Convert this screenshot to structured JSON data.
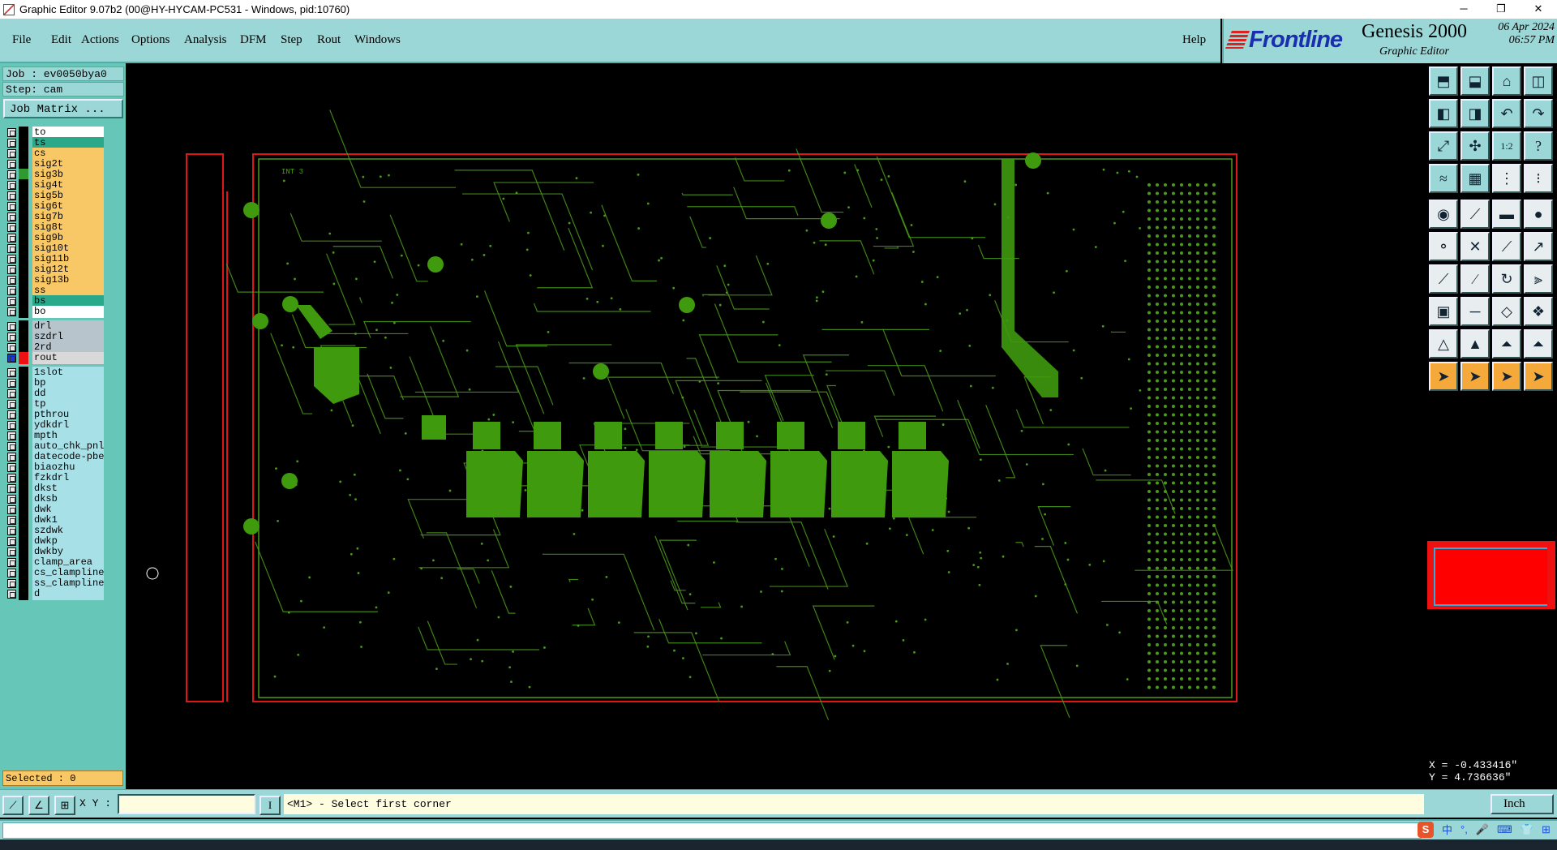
{
  "window": {
    "title": "Graphic Editor 9.07b2 (00@HY-HYCAM-PC531 - Windows, pid:10760)",
    "minimize": "─",
    "restore": "❐",
    "close": "✕"
  },
  "menu": {
    "items": [
      "File",
      "Edit",
      "Actions",
      "Options",
      "Analysis",
      "DFM",
      "Step",
      "Rout",
      "Windows"
    ],
    "help": "Help"
  },
  "brand": {
    "logo": "Frontline",
    "product": "Genesis 2000",
    "subtitle": "Graphic Editor",
    "date": "06 Apr 2024",
    "time": "06:57 PM"
  },
  "job": {
    "job_line": "Job : ev0050bya0",
    "step_line": "Step: cam",
    "matrix_button": "Job Matrix ..."
  },
  "layers": [
    {
      "name": "to",
      "bg": "#ffffff",
      "swatch": "#000000"
    },
    {
      "name": "ts",
      "bg": "#2aa88a",
      "swatch": "#000000"
    },
    {
      "name": "cs",
      "bg": "#f9c866",
      "swatch": "#000000"
    },
    {
      "name": "sig2t",
      "bg": "#f9c866",
      "swatch": "#000000"
    },
    {
      "name": "sig3b",
      "bg": "#f9c866",
      "swatch": "#2f9a2f"
    },
    {
      "name": "sig4t",
      "bg": "#f9c866",
      "swatch": "#000000"
    },
    {
      "name": "sig5b",
      "bg": "#f9c866",
      "swatch": "#000000"
    },
    {
      "name": "sig6t",
      "bg": "#f9c866",
      "swatch": "#000000"
    },
    {
      "name": "sig7b",
      "bg": "#f9c866",
      "swatch": "#000000"
    },
    {
      "name": "sig8t",
      "bg": "#f9c866",
      "swatch": "#000000"
    },
    {
      "name": "sig9b",
      "bg": "#f9c866",
      "swatch": "#000000"
    },
    {
      "name": "sig10t",
      "bg": "#f9c866",
      "swatch": "#000000"
    },
    {
      "name": "sig11b",
      "bg": "#f9c866",
      "swatch": "#000000"
    },
    {
      "name": "sig12t",
      "bg": "#f9c866",
      "swatch": "#000000"
    },
    {
      "name": "sig13b",
      "bg": "#f9c866",
      "swatch": "#000000"
    },
    {
      "name": "ss",
      "bg": "#f9c866",
      "swatch": "#000000"
    },
    {
      "name": "bs",
      "bg": "#2aa88a",
      "swatch": "#000000"
    },
    {
      "name": "bo",
      "bg": "#ffffff",
      "swatch": "#000000"
    },
    {
      "name": "drl",
      "bg": "#b7c4cc",
      "swatch": "#000000",
      "gap": true
    },
    {
      "name": "szdrl",
      "bg": "#b7c4cc",
      "swatch": "#000000"
    },
    {
      "name": "2rd",
      "bg": "#b7c4cc",
      "swatch": "#000000"
    },
    {
      "name": "rout",
      "bg": "#d9d9d9",
      "swatch": "#ee1111",
      "active": true
    },
    {
      "name": "1slot",
      "bg": "#a8e0e8",
      "swatch": "#000000",
      "gap": true
    },
    {
      "name": "bp",
      "bg": "#a8e0e8",
      "swatch": "#000000"
    },
    {
      "name": "dd",
      "bg": "#a8e0e8",
      "swatch": "#000000"
    },
    {
      "name": "tp",
      "bg": "#a8e0e8",
      "swatch": "#000000"
    },
    {
      "name": "pthrou",
      "bg": "#a8e0e8",
      "swatch": "#000000"
    },
    {
      "name": "ydkdrl",
      "bg": "#a8e0e8",
      "swatch": "#000000"
    },
    {
      "name": "mpth",
      "bg": "#a8e0e8",
      "swatch": "#000000"
    },
    {
      "name": "auto_chk_pnl",
      "bg": "#a8e0e8",
      "swatch": "#000000"
    },
    {
      "name": "datecode-pbe",
      "bg": "#a8e0e8",
      "swatch": "#000000"
    },
    {
      "name": "biaozhu",
      "bg": "#a8e0e8",
      "swatch": "#000000"
    },
    {
      "name": "fzkdrl",
      "bg": "#a8e0e8",
      "swatch": "#000000"
    },
    {
      "name": "dkst",
      "bg": "#a8e0e8",
      "swatch": "#000000"
    },
    {
      "name": "dksb",
      "bg": "#a8e0e8",
      "swatch": "#000000"
    },
    {
      "name": "dwk",
      "bg": "#a8e0e8",
      "swatch": "#000000"
    },
    {
      "name": "dwk1",
      "bg": "#a8e0e8",
      "swatch": "#000000"
    },
    {
      "name": "szdwk",
      "bg": "#a8e0e8",
      "swatch": "#000000"
    },
    {
      "name": "dwkp",
      "bg": "#a8e0e8",
      "swatch": "#000000"
    },
    {
      "name": "dwkby",
      "bg": "#a8e0e8",
      "swatch": "#000000"
    },
    {
      "name": "clamp_area",
      "bg": "#a8e0e8",
      "swatch": "#000000"
    },
    {
      "name": "cs_clampline",
      "bg": "#a8e0e8",
      "swatch": "#000000"
    },
    {
      "name": "ss_clampline",
      "bg": "#a8e0e8",
      "swatch": "#000000"
    },
    {
      "name": "d",
      "bg": "#a8e0e8",
      "swatch": "#000000"
    }
  ],
  "selected": "Selected : 0",
  "board": {
    "label": "INT 3",
    "colors": {
      "outline": "#e01515",
      "trace": "#4a9a1a",
      "copper": "#3f9a0e"
    }
  },
  "toolbar": [
    {
      "icon": "open-step-icon",
      "glyph": "⬒",
      "style": "cyan"
    },
    {
      "icon": "save-icon",
      "glyph": "⬓",
      "style": "cyan"
    },
    {
      "icon": "home-icon",
      "glyph": "⌂",
      "style": "cyan"
    },
    {
      "icon": "layout-icon",
      "glyph": "◫",
      "style": "cyan"
    },
    {
      "icon": "pan-left-icon",
      "glyph": "◧",
      "style": "cyan"
    },
    {
      "icon": "pan-right-icon",
      "glyph": "◨",
      "style": "cyan"
    },
    {
      "icon": "zoom-back-icon",
      "glyph": "↶",
      "style": "cyan"
    },
    {
      "icon": "zoom-forward-icon",
      "glyph": "↷",
      "style": "cyan"
    },
    {
      "icon": "zoom-fit-icon",
      "glyph": "⤢",
      "style": "cyan"
    },
    {
      "icon": "zoom-center-icon",
      "glyph": "✣",
      "style": "cyan"
    },
    {
      "icon": "zoom-1to2-icon",
      "glyph": "1:2",
      "style": "cyan"
    },
    {
      "icon": "help-icon",
      "glyph": "?",
      "style": "cyan"
    },
    {
      "icon": "snap-icon",
      "glyph": "≈",
      "style": "cyan"
    },
    {
      "icon": "grid-icon",
      "glyph": "▦",
      "style": "cyan"
    },
    {
      "icon": "measure-icon",
      "glyph": "⋮",
      "style": "white"
    },
    {
      "icon": "measure-points-icon",
      "glyph": "⁝",
      "style": "white"
    },
    {
      "icon": "select-pad-icon",
      "glyph": "◉",
      "style": "white"
    },
    {
      "icon": "select-line-icon",
      "glyph": "⟋",
      "style": "white"
    },
    {
      "icon": "ruler-icon",
      "glyph": "▬",
      "style": "white"
    },
    {
      "icon": "select-feature-icon",
      "glyph": "●",
      "style": "white"
    },
    {
      "icon": "net-select-icon",
      "glyph": "⚬",
      "style": "white"
    },
    {
      "icon": "cross-select-icon",
      "glyph": "✕",
      "style": "white"
    },
    {
      "icon": "connect-icon",
      "glyph": "⟋",
      "style": "white"
    },
    {
      "icon": "connect-arc-icon",
      "glyph": "↗",
      "style": "white"
    },
    {
      "icon": "add-line-icon",
      "glyph": "⟋",
      "style": "white"
    },
    {
      "icon": "add-line2-icon",
      "glyph": "∕",
      "style": "white"
    },
    {
      "icon": "add-arc-icon",
      "glyph": "↻",
      "style": "white"
    },
    {
      "icon": "split-icon",
      "glyph": "⫸",
      "style": "white"
    },
    {
      "icon": "pad-add-icon",
      "glyph": "▣",
      "style": "white"
    },
    {
      "icon": "line-add-icon",
      "glyph": "─",
      "style": "white"
    },
    {
      "icon": "polygon-icon",
      "glyph": "◇",
      "style": "white"
    },
    {
      "icon": "drill-icon",
      "glyph": "❖",
      "style": "white"
    },
    {
      "icon": "triangle-icon",
      "glyph": "△",
      "style": "white"
    },
    {
      "icon": "triangle2-icon",
      "glyph": "▲",
      "style": "white"
    },
    {
      "icon": "triangle3-icon",
      "glyph": "⏶",
      "style": "white"
    },
    {
      "icon": "triangle4-icon",
      "glyph": "⏶",
      "style": "white"
    },
    {
      "icon": "pointer-icon",
      "glyph": "➤",
      "style": "orange"
    },
    {
      "icon": "pointer2-icon",
      "glyph": "➤",
      "style": "orange"
    },
    {
      "icon": "pointer3-icon",
      "glyph": "➤",
      "style": "orange"
    },
    {
      "icon": "pointer4-icon",
      "glyph": "➤",
      "style": "orange"
    }
  ],
  "coords": {
    "x": "X = -0.433416\"",
    "y": "Y = 4.736636\""
  },
  "bottom": {
    "xy_label": "X Y :",
    "xy_value": "",
    "prompt": "<M1> - Select first corner",
    "units": "Inch",
    "input_mode": "I"
  },
  "ime": {
    "logo": "S",
    "lang": "中",
    "punct": "°,",
    "mic": "🎤",
    "kbd": "⌨",
    "shirt": "👕",
    "grid": "⊞"
  }
}
